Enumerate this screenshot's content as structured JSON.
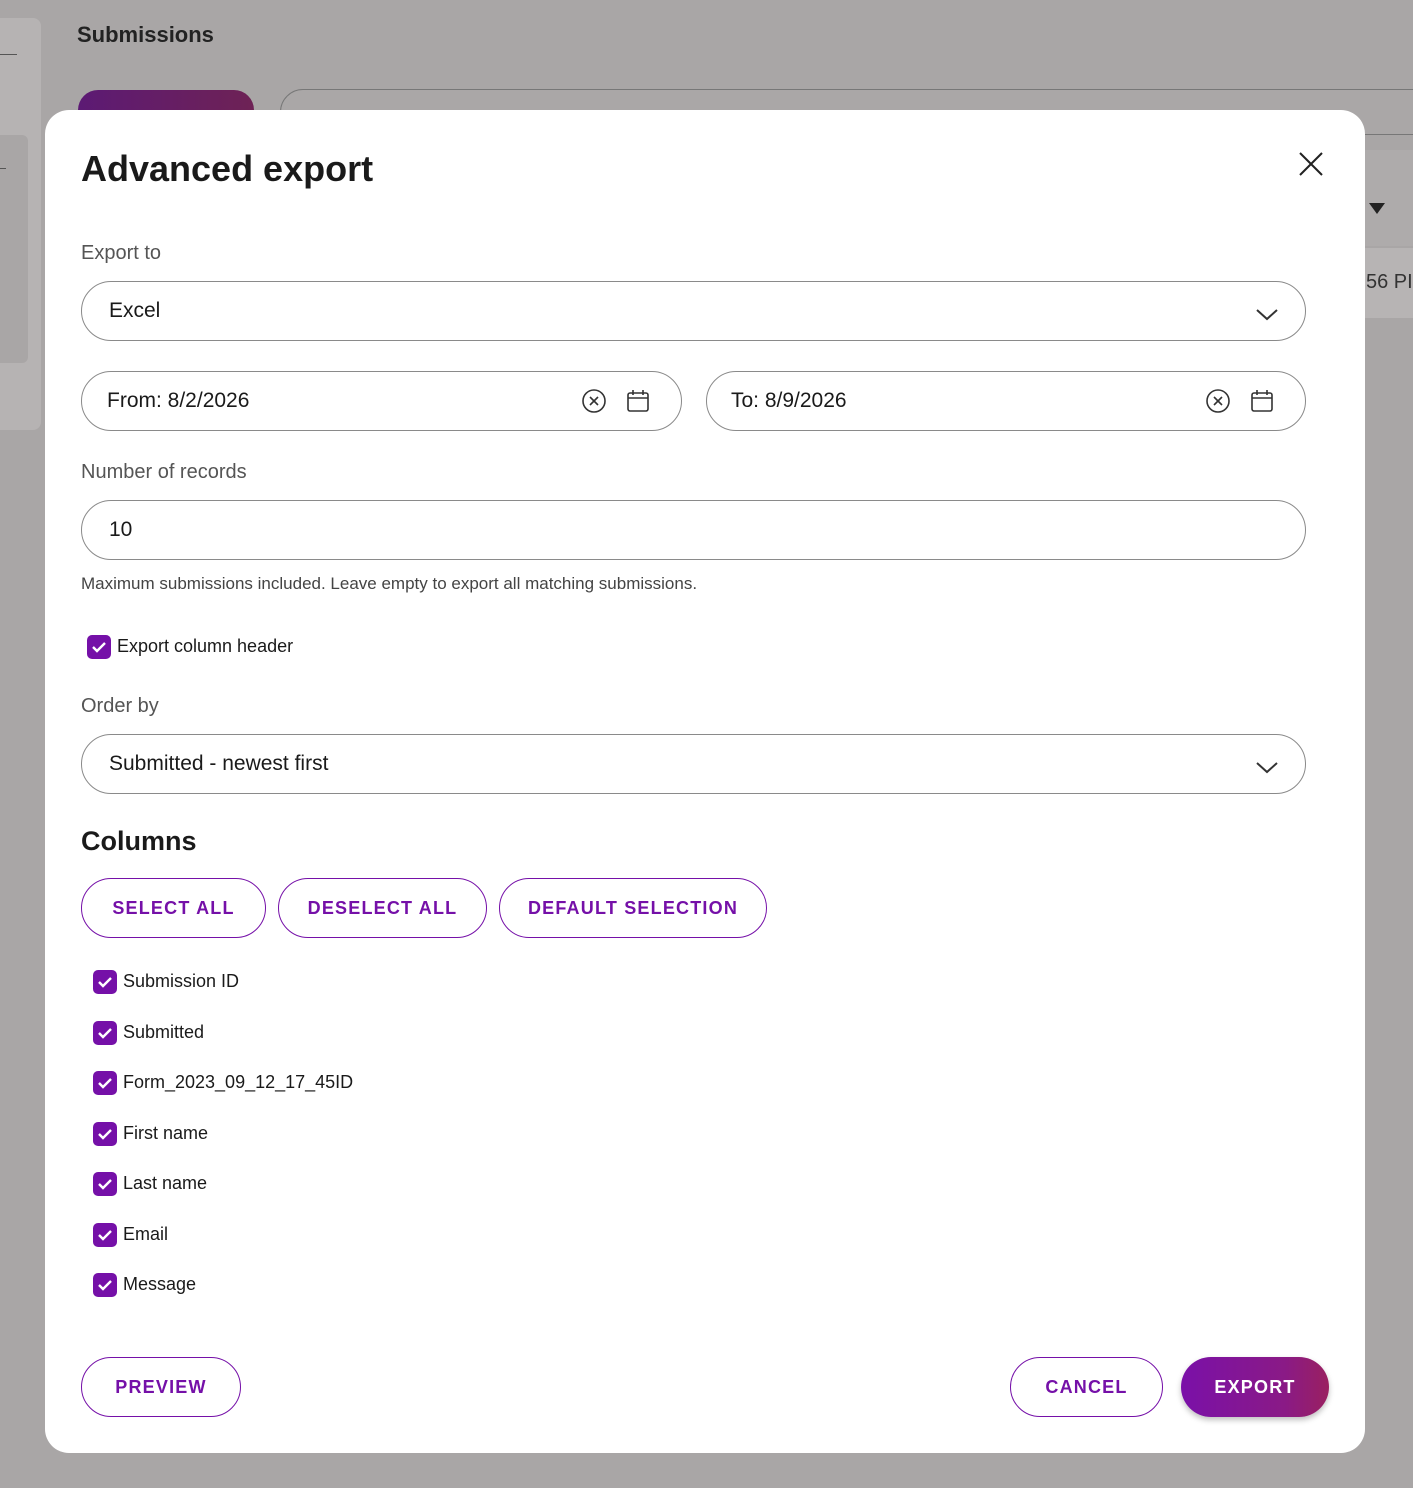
{
  "background": {
    "page_title": "Submissions",
    "row_time_fragment": "56 PI"
  },
  "modal": {
    "title": "Advanced export",
    "export_to": {
      "label": "Export to",
      "value": "Excel"
    },
    "date_from": {
      "value": "From: 8/2/2026"
    },
    "date_to": {
      "value": "To: 8/9/2026"
    },
    "records": {
      "label": "Number of records",
      "value": "10",
      "helper": "Maximum submissions included. Leave empty to export all matching submissions."
    },
    "export_header": {
      "label": "Export column header",
      "checked": true
    },
    "order_by": {
      "label": "Order by",
      "value": "Submitted - newest first"
    },
    "columns": {
      "title": "Columns",
      "select_all": "SELECT ALL",
      "deselect_all": "DESELECT ALL",
      "default_selection": "DEFAULT SELECTION",
      "items": [
        {
          "label": "Submission ID",
          "checked": true
        },
        {
          "label": "Submitted",
          "checked": true
        },
        {
          "label": "Form_2023_09_12_17_45ID",
          "checked": true
        },
        {
          "label": "First name",
          "checked": true
        },
        {
          "label": "Last name",
          "checked": true
        },
        {
          "label": "Email",
          "checked": true
        },
        {
          "label": "Message",
          "checked": true
        }
      ]
    },
    "footer": {
      "preview": "PREVIEW",
      "cancel": "CANCEL",
      "export": "EXPORT"
    }
  },
  "colors": {
    "accent": "#7510a8",
    "overlay": "#a9a6a6"
  },
  "icons": {
    "close": "close-icon",
    "chevron": "chevron-down-icon",
    "clear": "clear-circle-icon",
    "calendar": "calendar-icon",
    "check": "checkmark-icon"
  }
}
